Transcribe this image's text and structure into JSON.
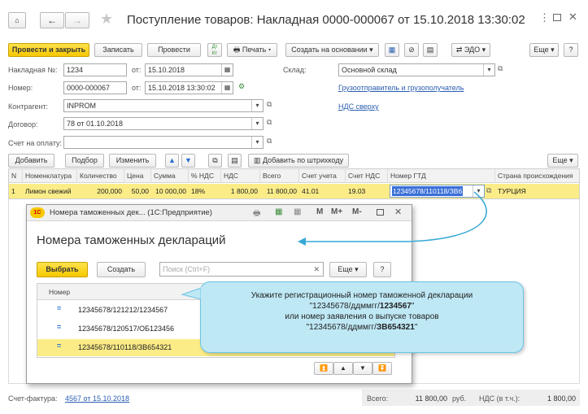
{
  "header": {
    "title": "Поступление товаров: Накладная 0000-000067 от 15.10.2018 13:30:02"
  },
  "toolbar": {
    "post_close": "Провести и закрыть",
    "save": "Записать",
    "post": "Провести",
    "print": "Печать",
    "create_based": "Создать на основании",
    "edo": "ЭДО",
    "more": "Еще"
  },
  "form": {
    "invoice_no_label": "Накладная №:",
    "invoice_no": "1234",
    "from_label": "от:",
    "invoice_date": "15.10.2018",
    "number_label": "Номер:",
    "number": "0000-000067",
    "from2_label": "от:",
    "number_date": "15.10.2018 13:30:02",
    "warehouse_label": "Склад:",
    "warehouse": "Основной склад",
    "shipper_link": "Грузоотправитель и грузополучатель",
    "contractor_label": "Контрагент:",
    "contractor": "INPROM",
    "vat_link": "НДС сверху",
    "contract_label": "Договор:",
    "contract": "78 от 01.10.2018",
    "payment_label": "Счет на оплату:",
    "payment": ""
  },
  "table_toolbar": {
    "add": "Добавить",
    "select": "Подбор",
    "change": "Изменить",
    "barcode": "Добавить по штрихкоду",
    "more": "Еще"
  },
  "table": {
    "headers": [
      "N",
      "Номенклатура",
      "Количество",
      "Цена",
      "Сумма",
      "% НДС",
      "НДС",
      "Всего",
      "Счет учета",
      "Счет НДС",
      "Номер ГТД",
      "Страна происхождения"
    ],
    "row": [
      "1",
      "Лимон свежий",
      "200,000",
      "50,00",
      "10 000,00",
      "18%",
      "1 800,00",
      "11 800,00",
      "41.01",
      "19.03",
      "12345678/110118/ЗВ6",
      "ТУРЦИЯ"
    ]
  },
  "popup": {
    "window_title": "Номера таможенных дек... (1С:Предприятие)",
    "title_buttons": [
      "M",
      "M+",
      "M-"
    ],
    "heading": "Номера таможенных деклараций",
    "select": "Выбрать",
    "create": "Создать",
    "search_placeholder": "Поиск (Ctrl+F)",
    "more": "Еще",
    "help": "?",
    "col_header": "Номер",
    "rows": [
      "12345678/121212/1234567",
      "12345678/120517/ОБ123456",
      "12345678/110118/ЗВ654321"
    ]
  },
  "callout": {
    "line1": "Укажите регистрационный номер таможенной декларации",
    "line2_pre": "\"12345678/ддммгг/",
    "line2_bold": "1234567",
    "line2_post": "\"",
    "line3": "или номер заявления о выпуске товаров",
    "line4_pre": "\"12345678/ддммгг/",
    "line4_bold": "ЗВ654321",
    "line4_post": "\""
  },
  "footer": {
    "invoice_label": "Счет-фактура:",
    "invoice_link": "4567 от 15.10.2018",
    "total_label": "Всего:",
    "total": "11 800,00",
    "currency": "руб.",
    "vat_label": "НДС (в т.ч.):",
    "vat": "1 800,00"
  },
  "colors": {
    "accent_yellow": "#f6c800",
    "selection_yellow": "#fbec88",
    "callout": "#bfe8f5",
    "link": "#2a5db0"
  }
}
